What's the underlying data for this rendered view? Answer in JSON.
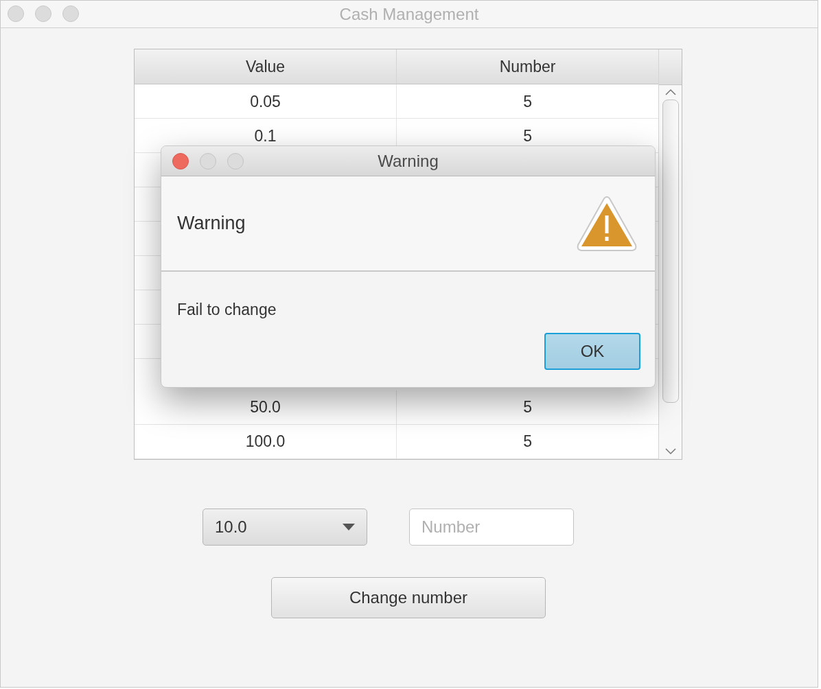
{
  "window": {
    "title": "Cash Management"
  },
  "table": {
    "columns": [
      "Value",
      "Number"
    ],
    "top_rows": [
      [
        "0.05",
        "5"
      ],
      [
        "0.1",
        "5"
      ]
    ],
    "bottom_rows": [
      [
        "50.0",
        "5"
      ],
      [
        "100.0",
        "5"
      ]
    ]
  },
  "value_dropdown": {
    "value": "10.0"
  },
  "number_field": {
    "placeholder": "Number"
  },
  "change_button": "Change number",
  "dialog": {
    "title": "Warning",
    "header": "Warning",
    "message": "Fail to change",
    "buttons": [
      "OK"
    ]
  }
}
